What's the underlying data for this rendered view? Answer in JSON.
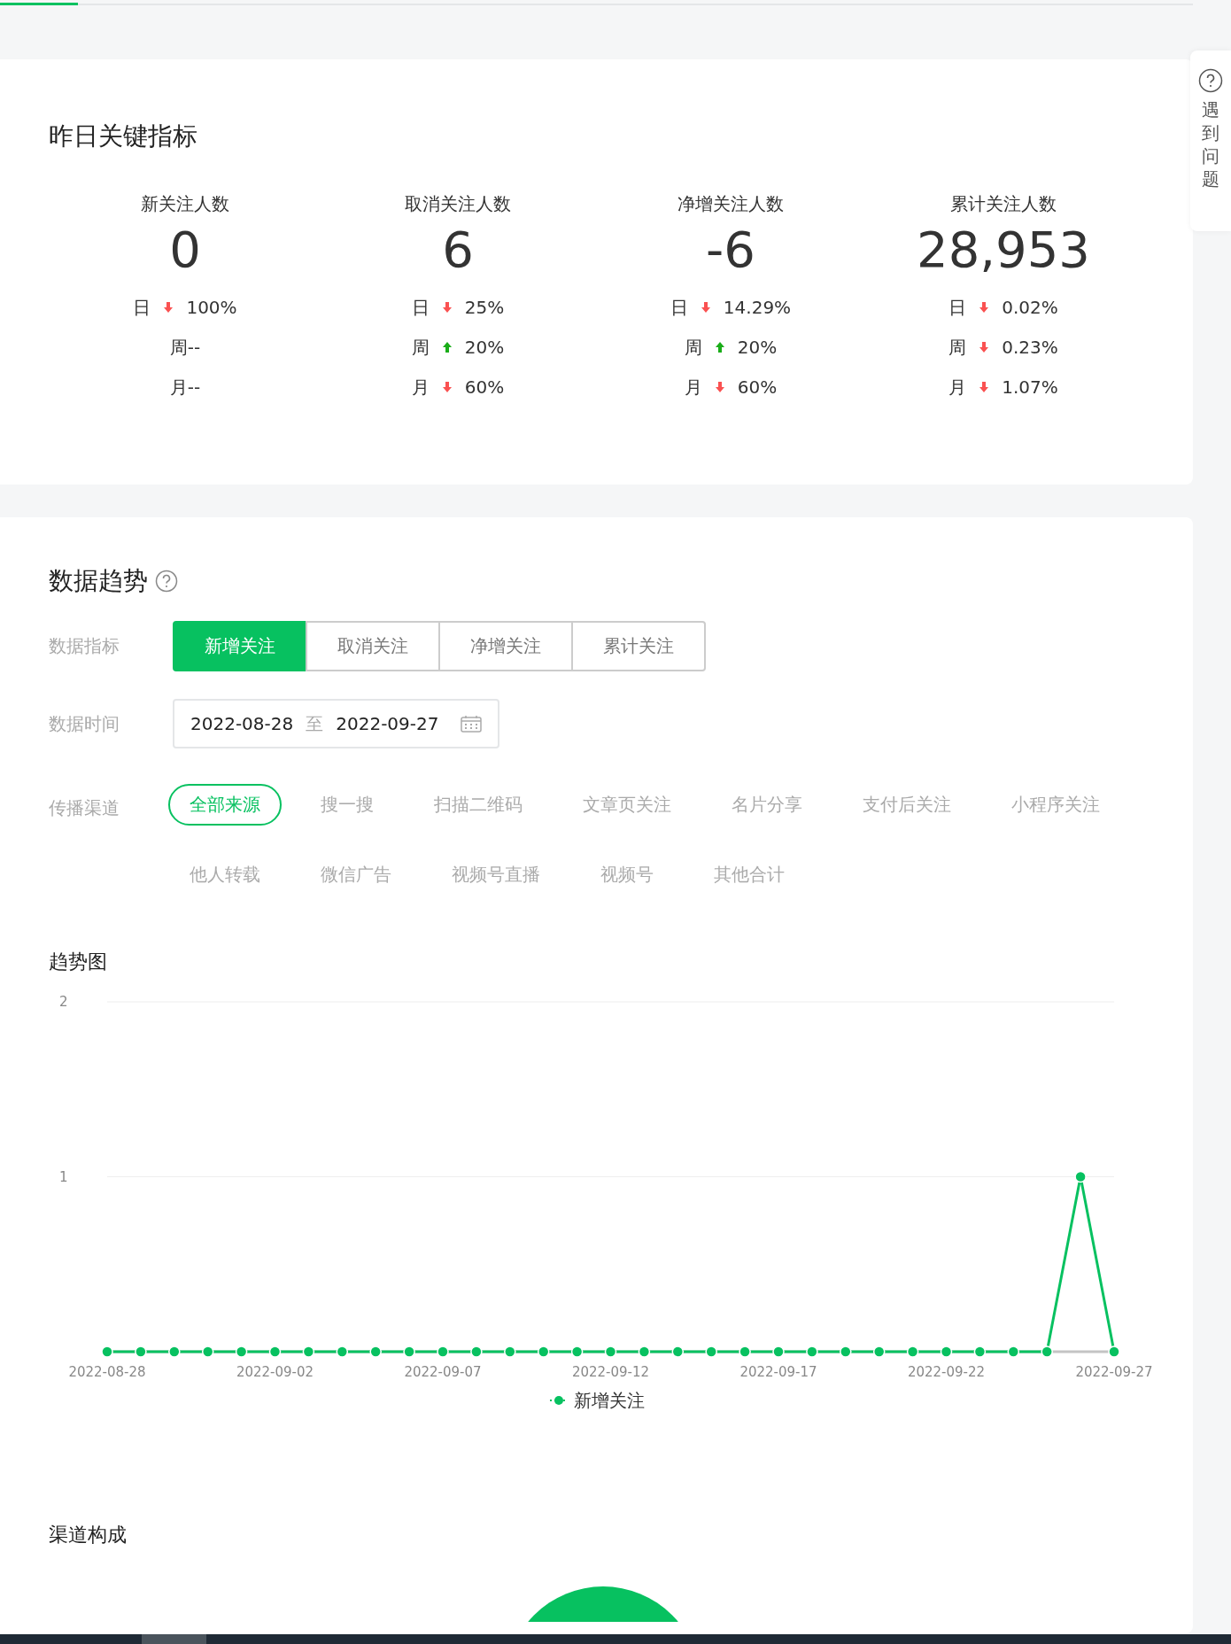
{
  "top_progress": {
    "level": 0.065
  },
  "help_tab": {
    "label": "遇到问题"
  },
  "key_metrics": {
    "title": "昨日关键指标",
    "metrics": [
      {
        "label": "新关注人数",
        "value": "0",
        "changes": [
          {
            "period": "日",
            "kind": "down",
            "value": "100%"
          },
          {
            "period": "周",
            "kind": "plain",
            "value": "--"
          },
          {
            "period": "月",
            "kind": "plain",
            "value": "--"
          }
        ]
      },
      {
        "label": "取消关注人数",
        "value": "6",
        "changes": [
          {
            "period": "日",
            "kind": "down",
            "value": "25%"
          },
          {
            "period": "周",
            "kind": "up",
            "value": "20%"
          },
          {
            "period": "月",
            "kind": "down",
            "value": "60%"
          }
        ]
      },
      {
        "label": "净增关注人数",
        "value": "-6",
        "changes": [
          {
            "period": "日",
            "kind": "down",
            "value": "14.29%"
          },
          {
            "period": "周",
            "kind": "up",
            "value": "20%"
          },
          {
            "period": "月",
            "kind": "down",
            "value": "60%"
          }
        ]
      },
      {
        "label": "累计关注人数",
        "value": "28,953",
        "changes": [
          {
            "period": "日",
            "kind": "down",
            "value": "0.02%"
          },
          {
            "period": "周",
            "kind": "down",
            "value": "0.23%"
          },
          {
            "period": "月",
            "kind": "down",
            "value": "1.07%"
          }
        ]
      }
    ]
  },
  "trend": {
    "title": "数据趋势",
    "indicator": {
      "label": "数据指标",
      "options": [
        {
          "label": "新增关注",
          "selected": true
        },
        {
          "label": "取消关注",
          "selected": false
        },
        {
          "label": "净增关注",
          "selected": false
        },
        {
          "label": "累计关注",
          "selected": false
        }
      ]
    },
    "date_range": {
      "label": "数据时间",
      "start": "2022-08-28",
      "separator": "至",
      "end": "2022-09-27"
    },
    "channels": {
      "label": "传播渠道",
      "options": [
        {
          "label": "全部来源",
          "selected": true
        },
        {
          "label": "搜一搜",
          "selected": false
        },
        {
          "label": "扫描二维码",
          "selected": false
        },
        {
          "label": "文章页关注",
          "selected": false
        },
        {
          "label": "名片分享",
          "selected": false
        },
        {
          "label": "支付后关注",
          "selected": false
        },
        {
          "label": "小程序关注",
          "selected": false
        },
        {
          "label": "他人转载",
          "selected": false
        },
        {
          "label": "微信广告",
          "selected": false
        },
        {
          "label": "视频号直播",
          "selected": false
        },
        {
          "label": "视频号",
          "selected": false
        },
        {
          "label": "其他合计",
          "selected": false
        }
      ]
    },
    "chart_title": "趋势图",
    "chart_data": {
      "type": "line",
      "x": [
        "2022-08-28",
        "2022-08-29",
        "2022-08-30",
        "2022-08-31",
        "2022-09-01",
        "2022-09-02",
        "2022-09-03",
        "2022-09-04",
        "2022-09-05",
        "2022-09-06",
        "2022-09-07",
        "2022-09-08",
        "2022-09-09",
        "2022-09-10",
        "2022-09-11",
        "2022-09-12",
        "2022-09-13",
        "2022-09-14",
        "2022-09-15",
        "2022-09-16",
        "2022-09-17",
        "2022-09-18",
        "2022-09-19",
        "2022-09-20",
        "2022-09-21",
        "2022-09-22",
        "2022-09-23",
        "2022-09-24",
        "2022-09-25",
        "2022-09-26",
        "2022-09-27"
      ],
      "series": [
        {
          "name": "新增关注",
          "color": "#07c160",
          "marker": "circle",
          "values": [
            0,
            0,
            0,
            0,
            0,
            0,
            0,
            0,
            0,
            0,
            0,
            0,
            0,
            0,
            0,
            0,
            0,
            0,
            0,
            0,
            0,
            0,
            0,
            0,
            0,
            0,
            0,
            0,
            0,
            1,
            0
          ]
        }
      ],
      "xlim": [
        "2022-08-28",
        "2022-09-27"
      ],
      "ylim": [
        0,
        2
      ],
      "yticks": [
        1,
        2
      ],
      "xticks": [
        "2022-08-28",
        "2022-09-02",
        "2022-09-07",
        "2022-09-12",
        "2022-09-17",
        "2022-09-22",
        "2022-09-27"
      ]
    },
    "composition_title": "渠道构成"
  }
}
